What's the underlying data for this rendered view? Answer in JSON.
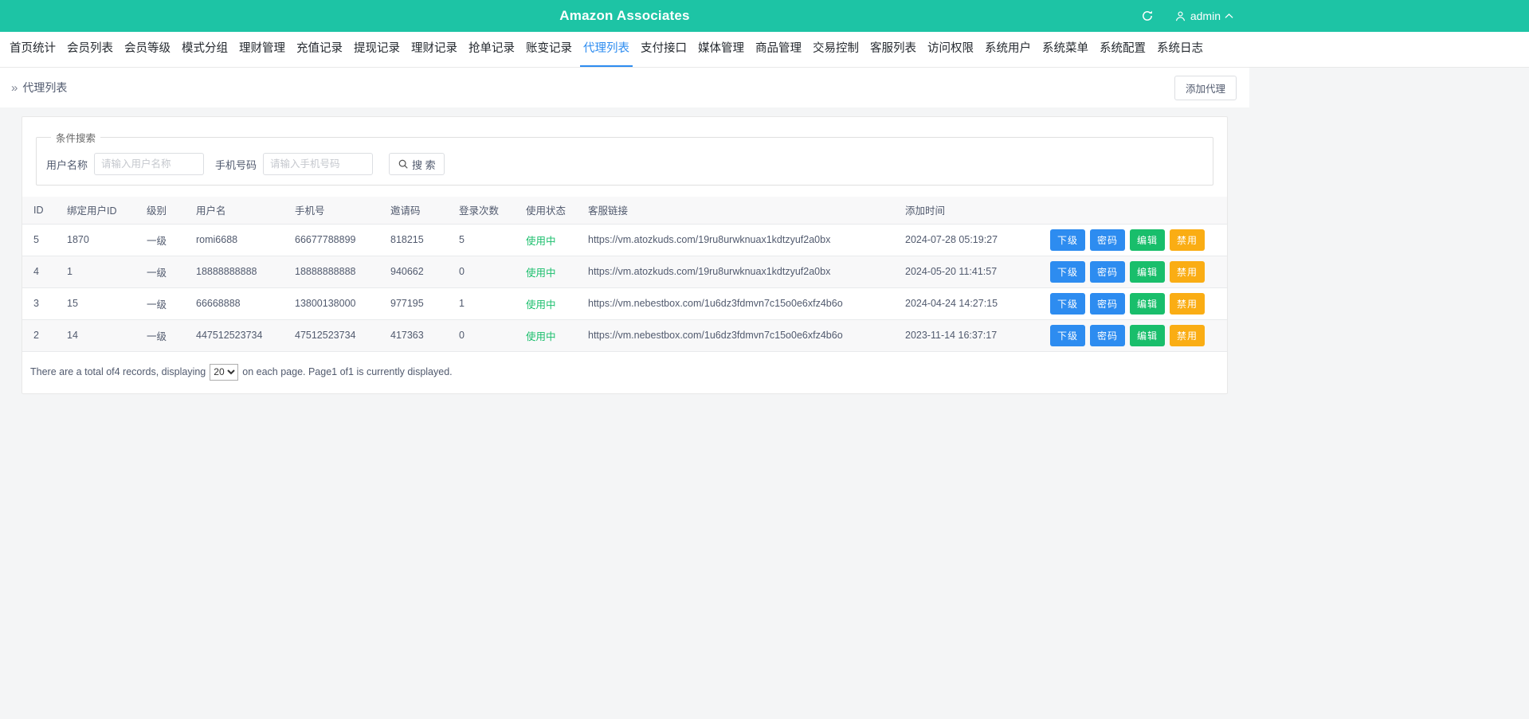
{
  "theme": {
    "header_bg": "#1dc4a5",
    "primary": "#2d8cf0",
    "success": "#19be6b",
    "warning": "#faad14",
    "page_bg": "#f4f5f6"
  },
  "header": {
    "title": "Amazon Associates",
    "user": "admin"
  },
  "nav": {
    "items": [
      {
        "id": "home-stats",
        "label": "首页统计",
        "active": false
      },
      {
        "id": "member-list",
        "label": "会员列表",
        "active": false
      },
      {
        "id": "member-level",
        "label": "会员等级",
        "active": false
      },
      {
        "id": "mode-group",
        "label": "模式分组",
        "active": false
      },
      {
        "id": "finance-manage",
        "label": "理财管理",
        "active": false
      },
      {
        "id": "recharge-records",
        "label": "充值记录",
        "active": false
      },
      {
        "id": "withdraw-records",
        "label": "提现记录",
        "active": false
      },
      {
        "id": "finance-records",
        "label": "理财记录",
        "active": false
      },
      {
        "id": "grab-order-records",
        "label": "抢单记录",
        "active": false
      },
      {
        "id": "account-change-records",
        "label": "账变记录",
        "active": false
      },
      {
        "id": "agent-list",
        "label": "代理列表",
        "active": true
      },
      {
        "id": "payment-api",
        "label": "支付接口",
        "active": false
      },
      {
        "id": "media-manage",
        "label": "媒体管理",
        "active": false
      },
      {
        "id": "product-manage",
        "label": "商品管理",
        "active": false
      },
      {
        "id": "trade-control",
        "label": "交易控制",
        "active": false
      },
      {
        "id": "service-list",
        "label": "客服列表",
        "active": false
      },
      {
        "id": "access-permission",
        "label": "访问权限",
        "active": false
      },
      {
        "id": "system-users",
        "label": "系统用户",
        "active": false
      },
      {
        "id": "system-menu",
        "label": "系统菜单",
        "active": false
      },
      {
        "id": "system-config",
        "label": "系统配置",
        "active": false
      },
      {
        "id": "system-logs",
        "label": "系统日志",
        "active": false
      }
    ]
  },
  "breadcrumb": {
    "icon": "»",
    "label": "代理列表",
    "add_button_label": "添加代理"
  },
  "search": {
    "legend": "条件搜索",
    "username_label": "用户名称",
    "username_placeholder": "请输入用户名称",
    "phone_label": "手机号码",
    "phone_placeholder": "请输入手机号码",
    "search_button_label": "搜 索"
  },
  "table": {
    "headers": [
      "ID",
      "绑定用户ID",
      "级别",
      "用户名",
      "手机号",
      "邀请码",
      "登录次数",
      "使用状态",
      "客服链接",
      "添加时间",
      ""
    ],
    "rows": [
      {
        "id": "5",
        "bind_user_id": "1870",
        "level": "一级",
        "username": "romi6688",
        "phone": "66677788899",
        "invite_code": "818215",
        "login_count": "5",
        "status": "使用中",
        "service_link": "https://vm.atozkuds.com/19ru8urwknuax1kdtzyuf2a0bx",
        "added_time": "2024-07-28 05:19:27"
      },
      {
        "id": "4",
        "bind_user_id": "1",
        "level": "一级",
        "username": "18888888888",
        "phone": "18888888888",
        "invite_code": "940662",
        "login_count": "0",
        "status": "使用中",
        "service_link": "https://vm.atozkuds.com/19ru8urwknuax1kdtzyuf2a0bx",
        "added_time": "2024-05-20 11:41:57"
      },
      {
        "id": "3",
        "bind_user_id": "15",
        "level": "一级",
        "username": "66668888",
        "phone": "13800138000",
        "invite_code": "977195",
        "login_count": "1",
        "status": "使用中",
        "service_link": "https://vm.nebestbox.com/1u6dz3fdmvn7c15o0e6xfz4b6o",
        "added_time": "2024-04-24 14:27:15"
      },
      {
        "id": "2",
        "bind_user_id": "14",
        "level": "一级",
        "username": "447512523734",
        "phone": "47512523734",
        "invite_code": "417363",
        "login_count": "0",
        "status": "使用中",
        "service_link": "https://vm.nebestbox.com/1u6dz3fdmvn7c15o0e6xfz4b6o",
        "added_time": "2023-11-14 16:37:17"
      }
    ],
    "action_buttons": [
      {
        "id": "sub-agent",
        "label": "下级",
        "color": "#2d8cf0"
      },
      {
        "id": "password",
        "label": "密码",
        "color": "#2d8cf0"
      },
      {
        "id": "edit",
        "label": "编辑",
        "color": "#19be6b"
      },
      {
        "id": "disable",
        "label": "禁用",
        "color": "#faad14"
      }
    ]
  },
  "pagination": {
    "total_text": "There are a total of4 records, displaying",
    "page_size": "20",
    "after_text": "on each page. Page1 of1 is currently displayed."
  }
}
